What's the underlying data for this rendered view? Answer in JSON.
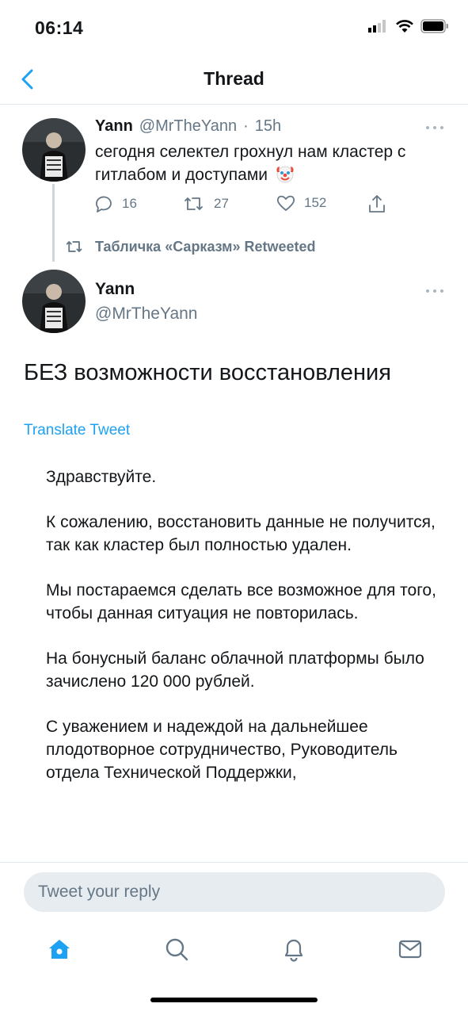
{
  "status": {
    "time": "06:14"
  },
  "nav": {
    "title": "Thread"
  },
  "tweet1": {
    "name": "Yann",
    "handle": "@MrTheYann",
    "time": "15h",
    "text": "сегодня селектел грохнул нам кластер с гитлабом и доступами",
    "emoji": "clown-face",
    "replies": "16",
    "retweets": "27",
    "likes": "152"
  },
  "retweet_label": "Табличка «Сарказм» Retweeted",
  "tweet2": {
    "name": "Yann",
    "handle": "@MrTheYann",
    "text": "БЕЗ возможности восстановления",
    "translate": "Translate Tweet",
    "letter": [
      "Здравствуйте.",
      "К сожалению, восстановить данные не получится, так как кластер был полностью удален.",
      "Мы постараемся сделать все возможное для того, чтобы данная ситуация не повторилась.",
      "На бонусный баланс облачной платформы было зачислено 120 000 рублей.",
      "С уважением и надеждой на дальнейшее плодотворное сотрудничество, Руководитель отдела Технической Поддержки,"
    ]
  },
  "reply": {
    "placeholder": "Tweet your reply"
  },
  "tabs": [
    "home-icon",
    "search-icon",
    "notifications-icon",
    "messages-icon"
  ],
  "colors": {
    "accent": "#1da1f2",
    "secondary_text": "#657786",
    "divider": "#e1e8ed"
  }
}
